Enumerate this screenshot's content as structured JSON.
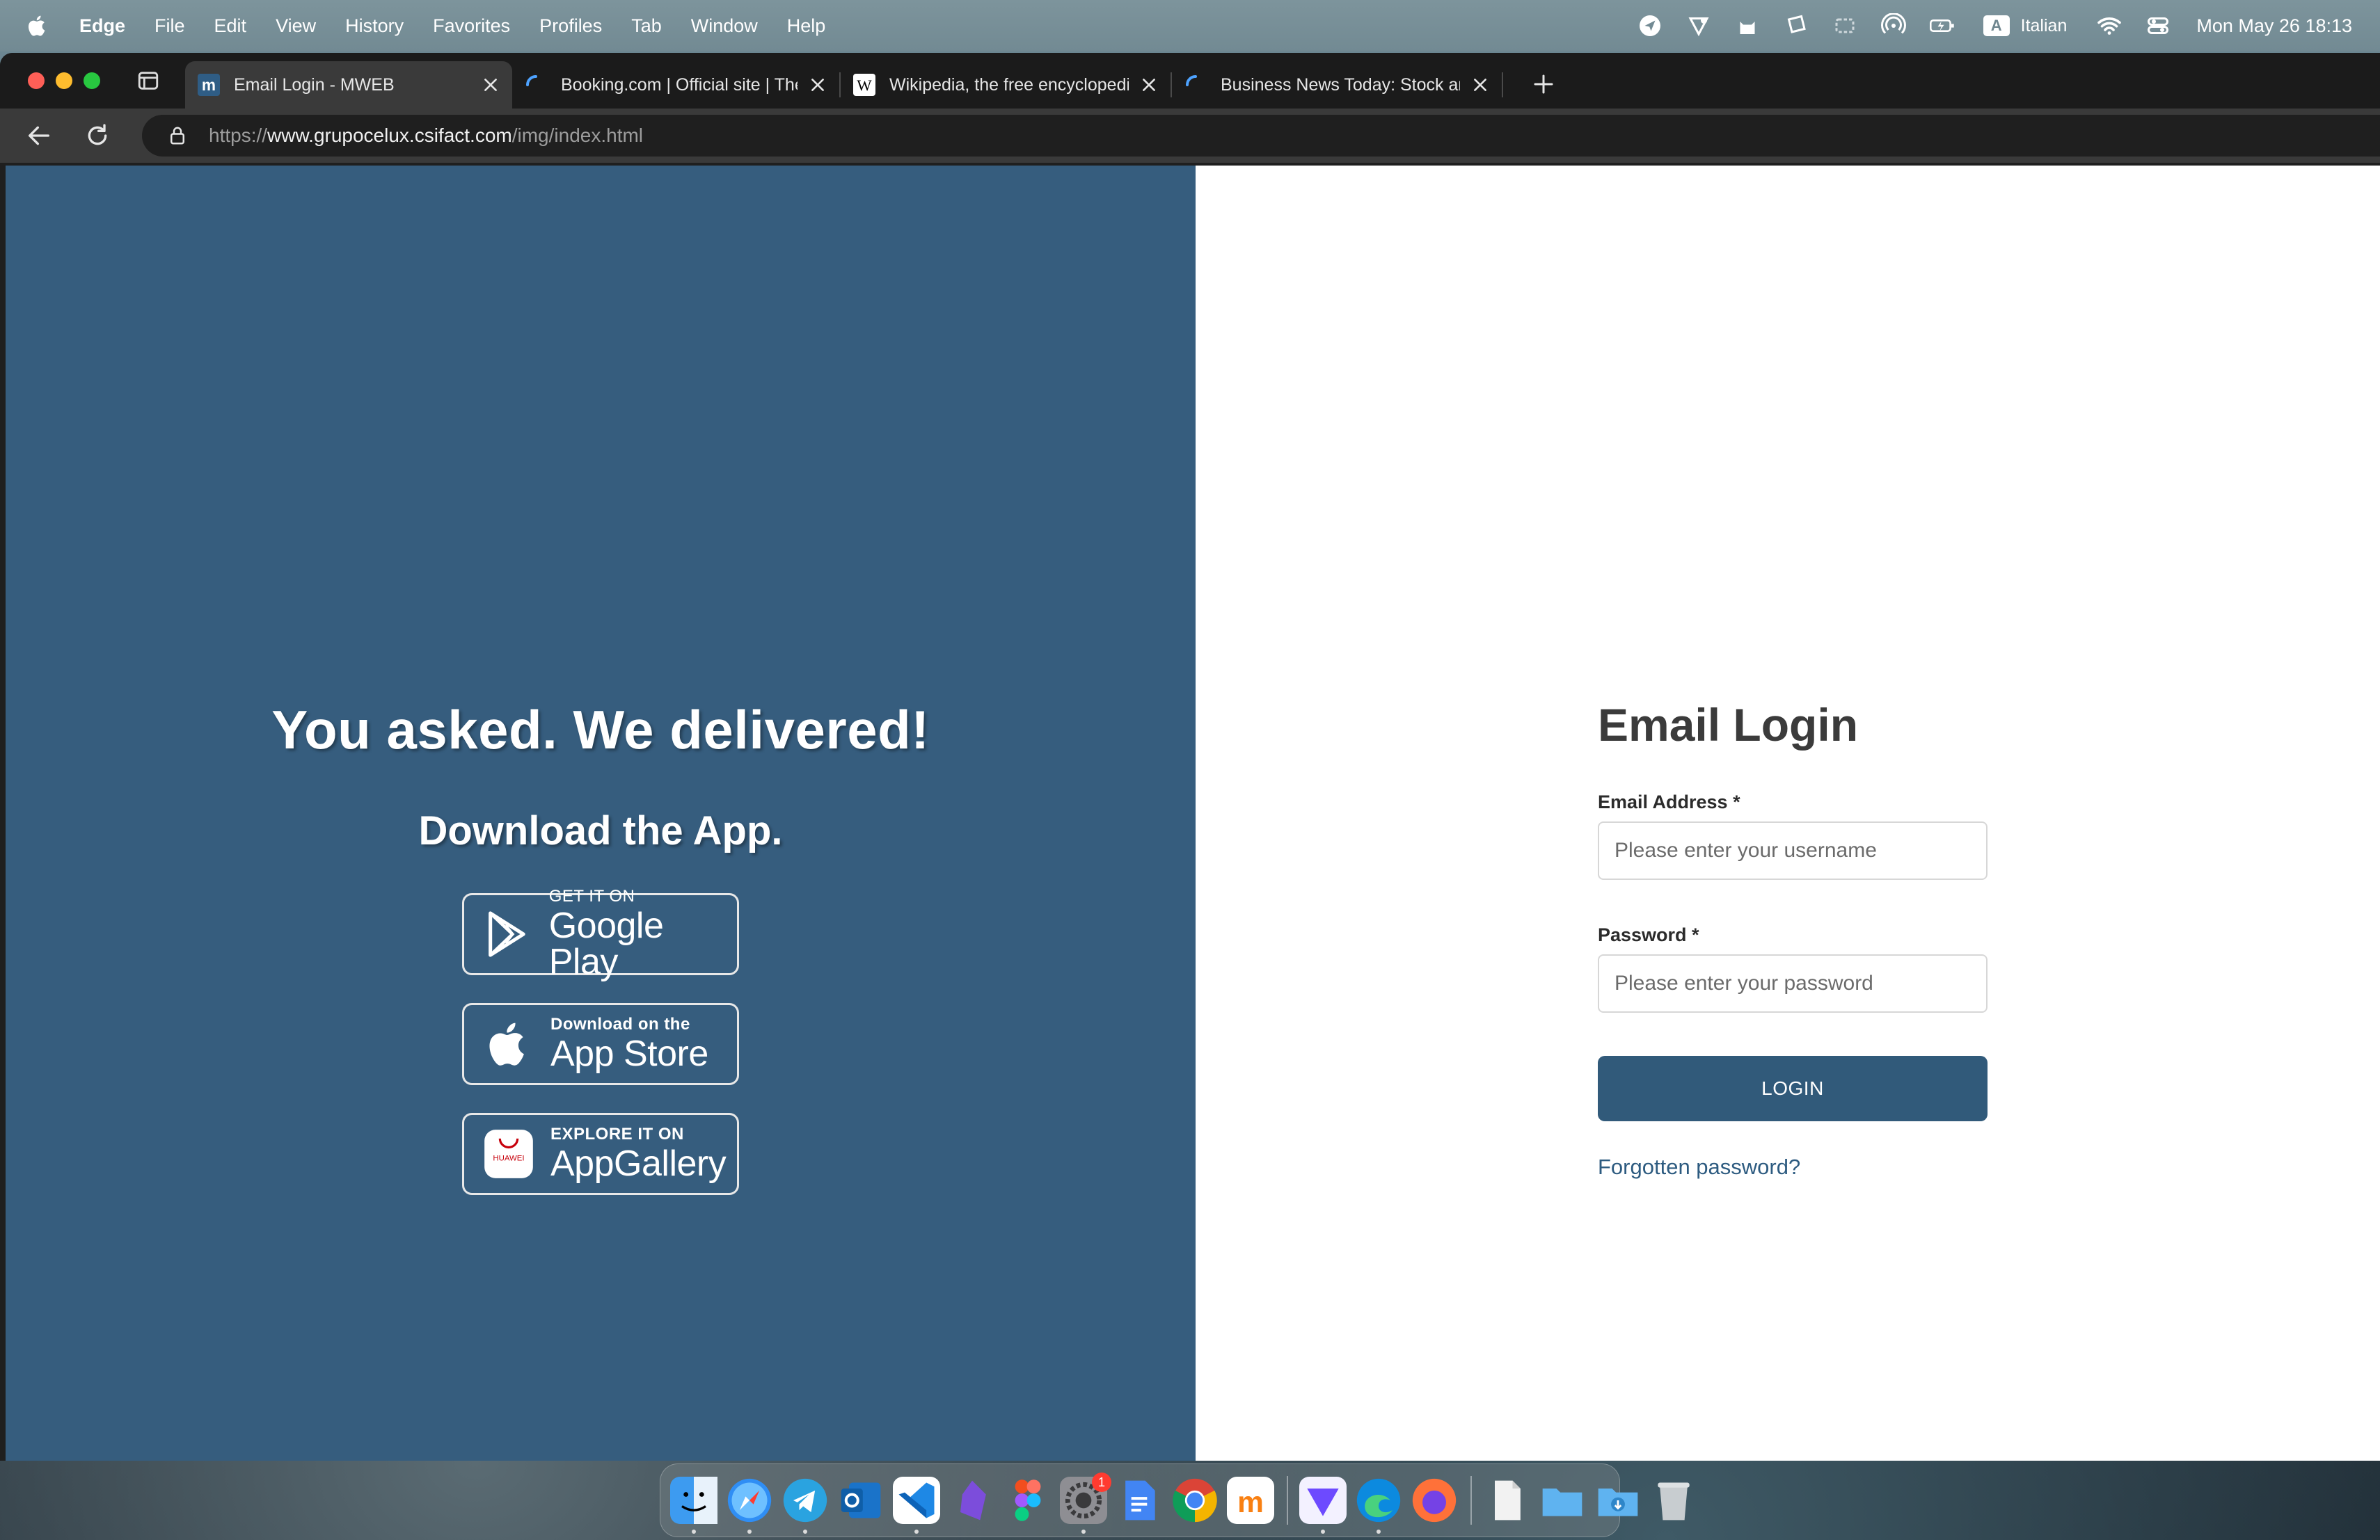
{
  "menubar": {
    "app_name": "Edge",
    "menus": [
      "File",
      "Edit",
      "View",
      "History",
      "Favorites",
      "Profiles",
      "Tab",
      "Window",
      "Help"
    ],
    "input_source_badge": "A",
    "input_source": "Italian",
    "clock": "Mon May 26  18:13"
  },
  "tabs": [
    {
      "title": "Email Login - MWEB",
      "favicon": "mweb-icon",
      "active": true
    },
    {
      "title": "Booking.com | Official site | The",
      "favicon": "loading-icon",
      "active": false
    },
    {
      "title": "Wikipedia, the free encyclopedia",
      "favicon": "wikipedia-icon",
      "active": false
    },
    {
      "title": "Business News Today: Stock an",
      "favicon": "loading-icon",
      "active": false
    }
  ],
  "address_bar": {
    "scheme": "https://",
    "host": "www.grupocelux.csifact.com",
    "path": "/img/index.html"
  },
  "promo": {
    "headline": "You asked. We delivered!",
    "subheadline": "Download the App.",
    "badges": [
      {
        "small": "GET IT ON",
        "big": "Google Play",
        "icon": "google-play-icon"
      },
      {
        "small": "Download on the",
        "big": "App Store",
        "icon": "apple-icon"
      },
      {
        "small": "EXPLORE IT ON",
        "big": "AppGallery",
        "icon": "huawei-appgallery-icon",
        "icon_text": "HUAWEI"
      }
    ],
    "background_color": "#365d7e"
  },
  "login": {
    "title": "Email Login",
    "email_label": "Email Address *",
    "email_placeholder": "Please enter your username",
    "password_label": "Password *",
    "password_placeholder": "Please enter your password",
    "button_label": "LOGIN",
    "forgot_link": "Forgotten password?",
    "accent_color": "#315a7a"
  },
  "dock": {
    "items": [
      "finder",
      "safari",
      "telegram",
      "outlook",
      "vscode",
      "obsidian",
      "figma",
      "system-settings",
      "google-docs",
      "chrome",
      "moodle",
      "proton-vpn",
      "edge",
      "firefox",
      "file",
      "folder",
      "downloads",
      "trash"
    ],
    "settings_badge": "1"
  }
}
